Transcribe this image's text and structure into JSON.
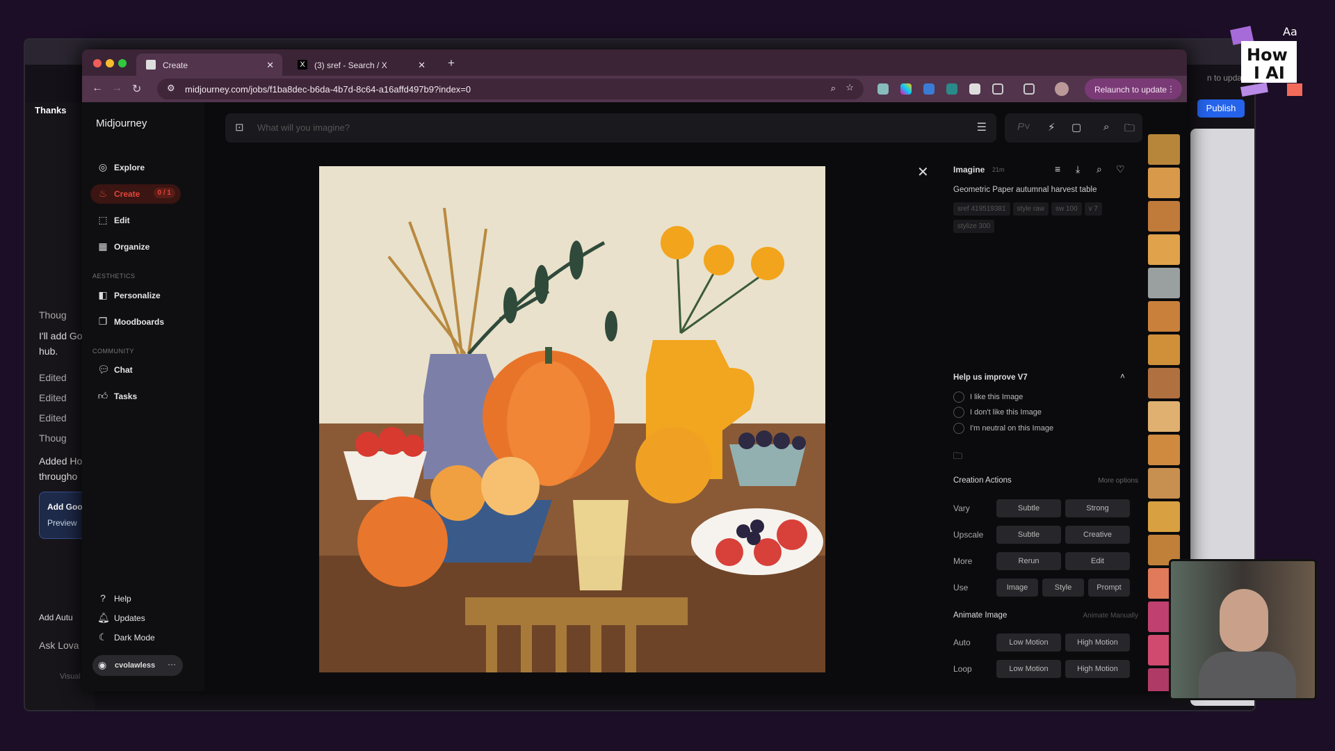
{
  "back_window": {
    "project_title": "Thanks",
    "chat_lines": [
      "Thoug",
      "I'll add Go",
      "hub.",
      "Edited",
      "Edited",
      "Edited",
      "Thoug",
      "Added Ho",
      "througho"
    ],
    "card_lines": [
      "Add Goo",
      "Preview"
    ],
    "suggestion": "Add Autu",
    "ask_placeholder": "Ask Lova",
    "visual_edits": "Visual edits",
    "update_hint": "n to update",
    "publish_label": "Publish"
  },
  "browser": {
    "tabs": [
      {
        "title": "Create",
        "active": true
      },
      {
        "title": "(3) sref - Search / X",
        "active": false
      }
    ],
    "url": "midjourney.com/jobs/f1ba8dec-b6da-4b7d-8c64-a16affd497b9?index=0",
    "relaunch_label": "Relaunch to update"
  },
  "sidebar": {
    "brand": "Midjourney",
    "items": [
      {
        "label": "Explore",
        "icon": "compass-icon"
      },
      {
        "label": "Create",
        "icon": "brush-icon",
        "badge": "0 / 1",
        "active": true
      },
      {
        "label": "Edit",
        "icon": "edit-icon"
      },
      {
        "label": "Organize",
        "icon": "grid-icon"
      }
    ],
    "aesthetics_heading": "AESTHETICS",
    "aesthetics": [
      {
        "label": "Personalize",
        "icon": "personalize-icon"
      },
      {
        "label": "Moodboards",
        "icon": "moodboard-icon"
      }
    ],
    "community_heading": "COMMUNITY",
    "community": [
      {
        "label": "Chat",
        "icon": "chat-icon"
      },
      {
        "label": "Tasks",
        "icon": "thumbs-up-icon"
      }
    ],
    "bottom": [
      {
        "label": "Help",
        "icon": "help-icon"
      },
      {
        "label": "Updates",
        "icon": "bell-icon"
      },
      {
        "label": "Dark Mode",
        "icon": "moon-icon"
      }
    ],
    "username": "cvolawless"
  },
  "prompt": {
    "placeholder": "What will you imagine?"
  },
  "detail": {
    "job_type": "Imagine",
    "age": "21m",
    "prompt_text": "Geometric Paper autumnal harvest table",
    "params": [
      "sref 419519381",
      "style raw",
      "sw 100",
      "v 7",
      "stylize 300"
    ],
    "feedback": {
      "title": "Help us improve V7",
      "options": [
        "I like this Image",
        "I don't like this Image",
        "I'm neutral on this Image"
      ]
    },
    "creation_actions": {
      "title": "Creation Actions",
      "more_link": "More options",
      "rows": [
        {
          "label": "Vary",
          "buttons": [
            "Subtle",
            "Strong"
          ]
        },
        {
          "label": "Upscale",
          "buttons": [
            "Subtle",
            "Creative"
          ]
        },
        {
          "label": "More",
          "buttons": [
            "Rerun",
            "Edit"
          ]
        },
        {
          "label": "Use",
          "buttons": [
            "Image",
            "Style",
            "Prompt"
          ]
        }
      ]
    },
    "animate": {
      "title": "Animate Image",
      "manual_link": "Animate Manually",
      "rows": [
        {
          "label": "Auto",
          "buttons": [
            "Low Motion",
            "High Motion"
          ]
        },
        {
          "label": "Loop",
          "buttons": [
            "Low Motion",
            "High Motion"
          ]
        }
      ]
    }
  },
  "overlay_logo": {
    "text_top": "Aa",
    "text": "How I AI"
  },
  "colors": {
    "accent_red": "#e2463a",
    "publish_blue": "#2563eb",
    "relaunch": "#7a3a76"
  }
}
